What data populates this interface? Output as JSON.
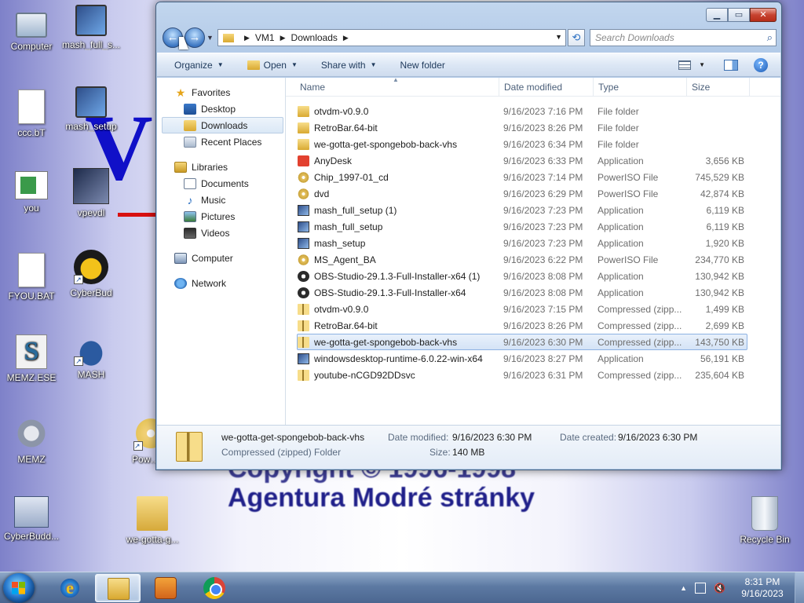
{
  "wallpaper": {
    "line1": "Copyright © 1996-1998",
    "line2": "Agentura Modré stránky",
    "big_letter": "V"
  },
  "desktop_icons": [
    {
      "label": "Computer",
      "icon": "computer-icon"
    },
    {
      "label": "mash_full_s...",
      "icon": "setup-icon"
    },
    {
      "label": "ccc.bT",
      "icon": "text-file-icon"
    },
    {
      "label": "mash_setup",
      "icon": "setup-icon"
    },
    {
      "label": "you",
      "icon": "image-file-icon"
    },
    {
      "label": "vpevdl",
      "icon": "app-icon"
    },
    {
      "label": "FYOU.BAT",
      "icon": "batch-file-icon"
    },
    {
      "label": "CyberBud",
      "icon": "cyberbud-icon"
    },
    {
      "label": "MEMZ.ESE",
      "icon": "script-icon"
    },
    {
      "label": "MASH",
      "icon": "mash-icon"
    },
    {
      "label": "MEMZ",
      "icon": "gear-icon"
    },
    {
      "label": "Powe...",
      "icon": "disc-icon"
    },
    {
      "label": "CyberBudd...",
      "icon": "window-icon"
    },
    {
      "label": "we-gotta-g...",
      "icon": "zip-folder-icon"
    },
    {
      "label": "Recycle Bin",
      "icon": "recycle-bin-icon"
    }
  ],
  "explorer": {
    "address": {
      "part1": "VM1",
      "part2": "Downloads"
    },
    "search_placeholder": "Search Downloads",
    "toolbar": {
      "organize": "Organize",
      "open": "Open",
      "share_with": "Share with",
      "new_folder": "New folder"
    },
    "nav": {
      "favorites": "Favorites",
      "favorites_items": [
        "Desktop",
        "Downloads",
        "Recent Places"
      ],
      "libraries": "Libraries",
      "libraries_items": [
        "Documents",
        "Music",
        "Pictures",
        "Videos"
      ],
      "computer": "Computer",
      "network": "Network"
    },
    "columns": {
      "name": "Name",
      "date": "Date modified",
      "type": "Type",
      "size": "Size"
    },
    "files": [
      {
        "name": "otvdm-v0.9.0",
        "date": "9/16/2023 7:16 PM",
        "type": "File folder",
        "size": "",
        "icon": "folder-icon"
      },
      {
        "name": "RetroBar.64-bit",
        "date": "9/16/2023 8:26 PM",
        "type": "File folder",
        "size": "",
        "icon": "folder-icon"
      },
      {
        "name": "we-gotta-get-spongebob-back-vhs",
        "date": "9/16/2023 6:34 PM",
        "type": "File folder",
        "size": "",
        "icon": "folder-icon"
      },
      {
        "name": "AnyDesk",
        "date": "9/16/2023 6:33 PM",
        "type": "Application",
        "size": "3,656 KB",
        "icon": "anydesk-icon"
      },
      {
        "name": "Chip_1997-01_cd",
        "date": "9/16/2023 7:14 PM",
        "type": "PowerISO File",
        "size": "745,529 KB",
        "icon": "disc-image-icon"
      },
      {
        "name": "dvd",
        "date": "9/16/2023 6:29 PM",
        "type": "PowerISO File",
        "size": "42,874 KB",
        "icon": "disc-image-icon"
      },
      {
        "name": "mash_full_setup (1)",
        "date": "9/16/2023 7:23 PM",
        "type": "Application",
        "size": "6,119 KB",
        "icon": "installer-icon"
      },
      {
        "name": "mash_full_setup",
        "date": "9/16/2023 7:23 PM",
        "type": "Application",
        "size": "6,119 KB",
        "icon": "installer-icon"
      },
      {
        "name": "mash_setup",
        "date": "9/16/2023 7:23 PM",
        "type": "Application",
        "size": "1,920 KB",
        "icon": "installer-icon"
      },
      {
        "name": "MS_Agent_BA",
        "date": "9/16/2023 6:22 PM",
        "type": "PowerISO File",
        "size": "234,770 KB",
        "icon": "disc-image-icon"
      },
      {
        "name": "OBS-Studio-29.1.3-Full-Installer-x64 (1)",
        "date": "9/16/2023 8:08 PM",
        "type": "Application",
        "size": "130,942 KB",
        "icon": "obs-icon"
      },
      {
        "name": "OBS-Studio-29.1.3-Full-Installer-x64",
        "date": "9/16/2023 8:08 PM",
        "type": "Application",
        "size": "130,942 KB",
        "icon": "obs-icon"
      },
      {
        "name": "otvdm-v0.9.0",
        "date": "9/16/2023 7:15 PM",
        "type": "Compressed (zipp...",
        "size": "1,499 KB",
        "icon": "zip-icon"
      },
      {
        "name": "RetroBar.64-bit",
        "date": "9/16/2023 8:26 PM",
        "type": "Compressed (zipp...",
        "size": "2,699 KB",
        "icon": "zip-icon"
      },
      {
        "name": "we-gotta-get-spongebob-back-vhs",
        "date": "9/16/2023 6:30 PM",
        "type": "Compressed (zipp...",
        "size": "143,750 KB",
        "icon": "zip-icon",
        "selected": true
      },
      {
        "name": "windowsdesktop-runtime-6.0.22-win-x64",
        "date": "9/16/2023 8:27 PM",
        "type": "Application",
        "size": "56,191 KB",
        "icon": "installer-icon"
      },
      {
        "name": "youtube-nCGD92DDsvc",
        "date": "9/16/2023 6:31 PM",
        "type": "Compressed (zipp...",
        "size": "235,604 KB",
        "icon": "zip-icon"
      }
    ],
    "details": {
      "name": "we-gotta-get-spongebob-back-vhs",
      "type": "Compressed (zipped) Folder",
      "modified_label": "Date modified:",
      "modified_value": "9/16/2023 6:30 PM",
      "created_label": "Date created:",
      "created_value": "9/16/2023 6:30 PM",
      "size_label": "Size:",
      "size_value": "140 MB"
    }
  },
  "taskbar": {
    "pinned": [
      "internet-explorer-icon",
      "windows-explorer-icon",
      "media-center-icon",
      "chrome-icon"
    ],
    "clock_time": "8:31 PM",
    "clock_date": "9/16/2023"
  }
}
